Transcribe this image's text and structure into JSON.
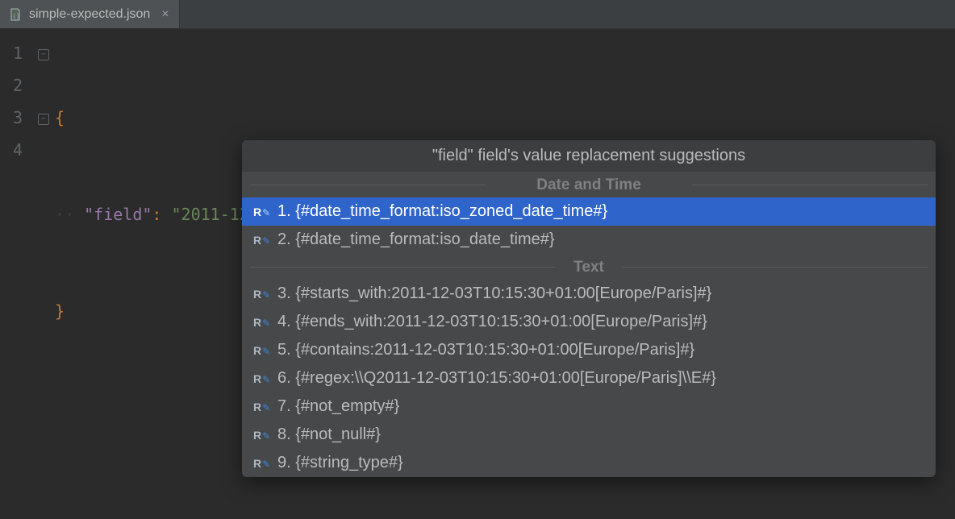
{
  "tab": {
    "filename": "simple-expected.json"
  },
  "gutter": [
    "1",
    "2",
    "3",
    "4"
  ],
  "code": {
    "line1_brace": "{",
    "line2_key": "\"field\"",
    "line2_colon": ":",
    "line2_value": "\"2011-12-03T10:15:30+01:00[Europe/Paris]\"",
    "line3_brace": "}"
  },
  "popup": {
    "title": "\"field\" field's value replacement suggestions",
    "sections": [
      {
        "header": "Date and Time",
        "items": [
          {
            "label": "1. {#date_time_format:iso_zoned_date_time#}",
            "selected": true
          },
          {
            "label": "2. {#date_time_format:iso_date_time#}",
            "selected": false
          }
        ]
      },
      {
        "header": "Text",
        "items": [
          {
            "label": "3. {#starts_with:2011-12-03T10:15:30+01:00[Europe/Paris]#}",
            "selected": false
          },
          {
            "label": "4. {#ends_with:2011-12-03T10:15:30+01:00[Europe/Paris]#}",
            "selected": false
          },
          {
            "label": "5. {#contains:2011-12-03T10:15:30+01:00[Europe/Paris]#}",
            "selected": false
          },
          {
            "label": "6. {#regex:\\\\Q2011-12-03T10:15:30+01:00[Europe/Paris]\\\\E#}",
            "selected": false
          },
          {
            "label": "7. {#not_empty#}",
            "selected": false
          },
          {
            "label": "8. {#not_null#}",
            "selected": false
          },
          {
            "label": "9. {#string_type#}",
            "selected": false
          }
        ]
      }
    ]
  }
}
